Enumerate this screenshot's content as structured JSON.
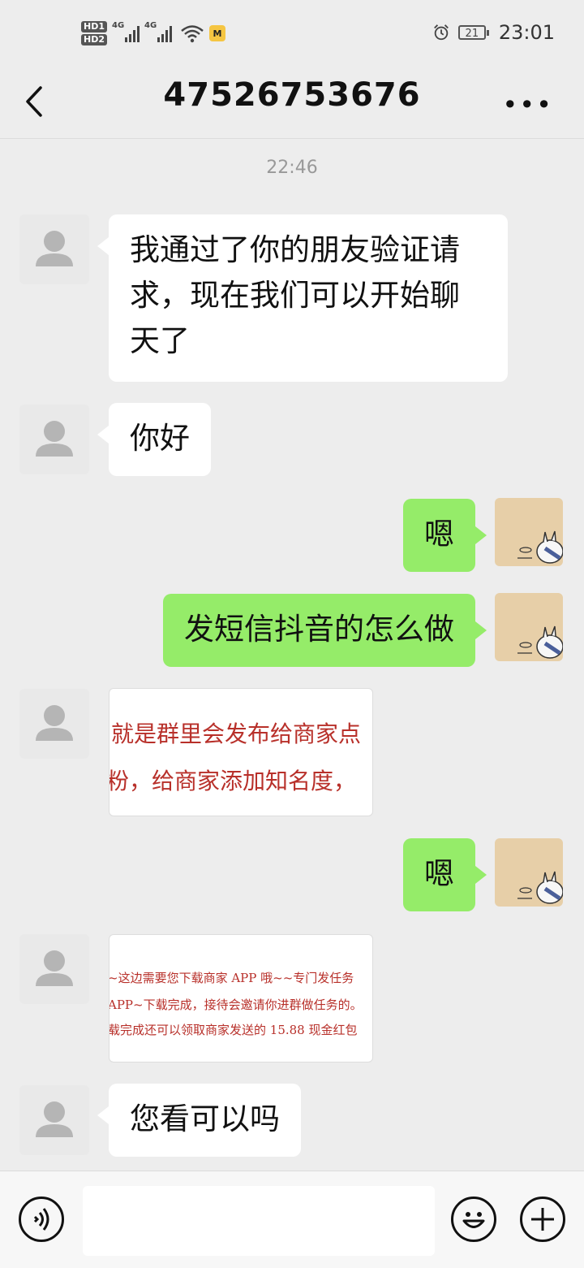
{
  "status_bar": {
    "hd1": "HD1",
    "hd2": "HD2",
    "net1": "4G",
    "net2": "4G",
    "app_badge": "M",
    "battery": "21",
    "time": "23:01"
  },
  "header": {
    "title": "47526753676",
    "back_icon": "chevron-left-icon",
    "more_icon": "more-dots-icon",
    "more_glyph": "•••"
  },
  "timestamp": "22:46",
  "messages": [
    {
      "side": "left",
      "type": "text",
      "text": "我通过了你的朋友验证请求，现在我们可以开始聊天了"
    },
    {
      "side": "left",
      "type": "text",
      "text": "你好"
    },
    {
      "side": "right",
      "type": "text",
      "text": "嗯"
    },
    {
      "side": "right",
      "type": "text",
      "text": "发短信抖音的怎么做"
    },
    {
      "side": "left",
      "type": "image",
      "lines": [
        "就是群里会发布给商家点",
        "粉，给商家添加知名度，"
      ]
    },
    {
      "side": "right",
      "type": "text",
      "text": "嗯"
    },
    {
      "side": "left",
      "type": "image",
      "lines": [
        "~这边需要您下载商家 APP 哦~~专门发任务",
        "APP~下载完成，接待会邀请你进群做任务的。",
        "载完成还可以领取商家发送的 15.88 现金红包"
      ]
    },
    {
      "side": "left",
      "type": "text",
      "text": "您看可以吗"
    }
  ],
  "input_bar": {
    "voice_icon": "voice-icon",
    "input_value": "",
    "emoji_icon": "emoji-icon",
    "plus_icon": "plus-icon"
  },
  "colors": {
    "background": "#ededed",
    "sent_bubble": "#95ec69",
    "received_bubble": "#ffffff",
    "image_text": "#b8302a"
  }
}
